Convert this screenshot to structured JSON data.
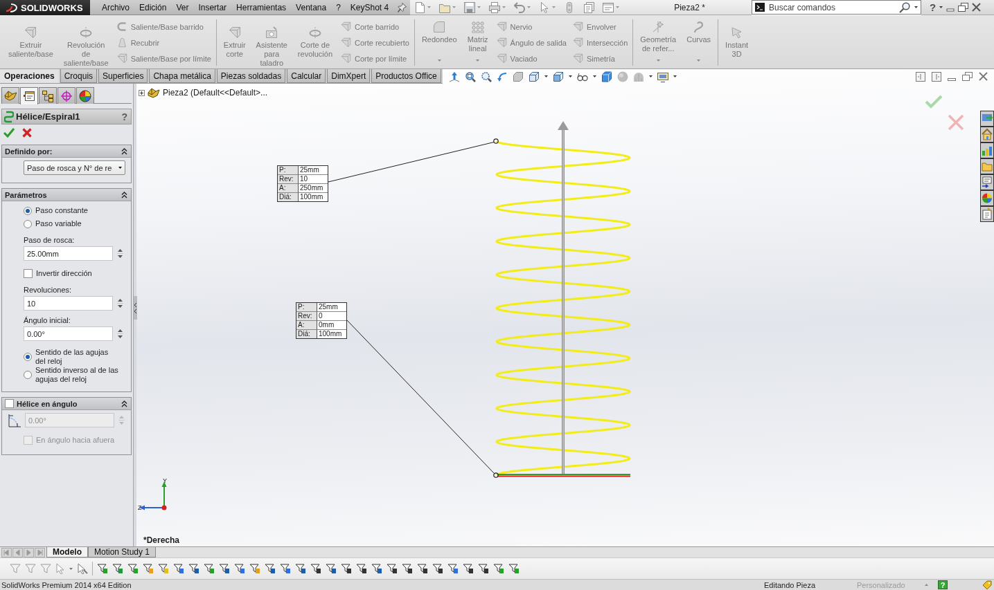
{
  "title_bar": {
    "logo": "SOLIDWORKS",
    "menu": [
      "Archivo",
      "Edición",
      "Ver",
      "Insertar",
      "Herramientas",
      "Ventana",
      "?",
      "KeyShot 4"
    ],
    "document_title": "Pieza2 *",
    "search": {
      "placeholder": "Buscar comandos"
    },
    "help": "?"
  },
  "ribbon": {
    "disabled": true,
    "groups": [
      {
        "items": [
          {
            "kind": "large",
            "label": "Extruir\nsaliente/base",
            "dropdown": false
          },
          {
            "kind": "large",
            "label": "Revolución\nde\nsaliente/base",
            "dropdown": false
          },
          {
            "kind": "stack",
            "labels": [
              "Saliente/Base barrido",
              "Recubrir",
              "Saliente/Base por límite"
            ]
          }
        ]
      },
      {
        "items": [
          {
            "kind": "large",
            "label": "Extruir\ncorte",
            "dropdown": false
          },
          {
            "kind": "large",
            "label": "Asistente\npara\ntaladro",
            "dropdown": false
          },
          {
            "kind": "large",
            "label": "Corte de\nrevolución",
            "dropdown": false
          },
          {
            "kind": "stack",
            "labels": [
              "Corte barrido",
              "Corte recubierto",
              "Corte por límite"
            ]
          }
        ]
      },
      {
        "items": [
          {
            "kind": "large",
            "label": "Redondeo",
            "dropdown": true
          },
          {
            "kind": "large",
            "label": "Matriz\nlineal",
            "dropdown": true
          },
          {
            "kind": "stack",
            "labels": [
              "Nervio",
              "Ángulo de salida",
              "Vaciado"
            ]
          },
          {
            "kind": "stack",
            "labels": [
              "Envolver",
              "Intersección",
              "Simetría"
            ]
          }
        ]
      },
      {
        "items": [
          {
            "kind": "large",
            "label": "Geometría\nde refer...",
            "dropdown": true
          },
          {
            "kind": "large",
            "label": "Curvas",
            "dropdown": true
          }
        ]
      },
      {
        "items": [
          {
            "kind": "large",
            "label": "Instant\n3D",
            "dropdown": false
          }
        ]
      }
    ]
  },
  "command_tabs": [
    {
      "label": "Operaciones",
      "selected": true
    },
    {
      "label": "Croquis",
      "selected": false
    },
    {
      "label": "Superficies",
      "selected": false
    },
    {
      "label": "Chapa metálica",
      "selected": false
    },
    {
      "label": "Piezas soldadas",
      "selected": false
    },
    {
      "label": "Calcular",
      "selected": false
    },
    {
      "label": "DimXpert",
      "selected": false
    },
    {
      "label": "Productos Office",
      "selected": false
    }
  ],
  "property_manager": {
    "tabs": [
      {
        "selected": false
      },
      {
        "selected": true
      },
      {
        "selected": false
      },
      {
        "selected": false
      },
      {
        "selected": false
      }
    ],
    "title": "Hélice/Espiral1",
    "help": "?",
    "sections": [
      {
        "title": "Definido por:",
        "expanded": true,
        "items": [
          {
            "kind": "dropdown",
            "value": "Paso de rosca y N° de re"
          }
        ]
      },
      {
        "title": "Parámetros",
        "expanded": true,
        "items": [
          {
            "kind": "radio",
            "label": "Paso constante",
            "selected": true
          },
          {
            "kind": "radio",
            "label": "Paso variable",
            "selected": false
          },
          {
            "kind": "spin",
            "label": "Paso de rosca:",
            "value": "25.00mm"
          },
          {
            "kind": "checkbox",
            "label": "Invertir dirección",
            "checked": false
          },
          {
            "kind": "spin",
            "label": "Revoluciones:",
            "value": "10"
          },
          {
            "kind": "spin",
            "label": "Ángulo inicial:",
            "value": "0.00°"
          },
          {
            "kind": "radio",
            "label": "Sentido de las agujas\ndel reloj",
            "selected": true
          },
          {
            "kind": "radio",
            "label": "Sentido inverso al de las\nagujas del reloj",
            "selected": false
          }
        ]
      },
      {
        "title": "Hélice en ángulo",
        "checked": false,
        "expanded": true,
        "items": [
          {
            "kind": "angle",
            "value": "0.00°",
            "disabled": true
          },
          {
            "kind": "checkbox",
            "label": "En ángulo hacia afuera",
            "checked": false,
            "disabled": true
          }
        ]
      }
    ]
  },
  "viewport": {
    "tree_root": "Pieza2 (Default<<Default>...",
    "callouts": [
      {
        "rows": [
          {
            "label": "P:",
            "value": "25mm"
          },
          {
            "label": "Rev:",
            "value": "10"
          },
          {
            "label": "A:",
            "value": "250mm"
          },
          {
            "label": "Diá:",
            "value": "100mm"
          }
        ]
      },
      {
        "rows": [
          {
            "label": "P:",
            "value": "25mm"
          },
          {
            "label": "Rev:",
            "value": "0"
          },
          {
            "label": "A:",
            "value": "0mm"
          },
          {
            "label": "Diá:",
            "value": "100mm"
          }
        ]
      }
    ],
    "triad": {
      "y": "Y",
      "z": "Z"
    },
    "view_name": "*Derecha"
  },
  "bottom_tabs": [
    {
      "label": "Modelo",
      "selected": true
    },
    {
      "label": "Motion Study 1",
      "selected": false
    }
  ],
  "status_bar": {
    "edition": "SolidWorks Premium 2014 x64 Edition",
    "mode": "Editando Pieza",
    "units": "Personalizado",
    "help": "?"
  }
}
